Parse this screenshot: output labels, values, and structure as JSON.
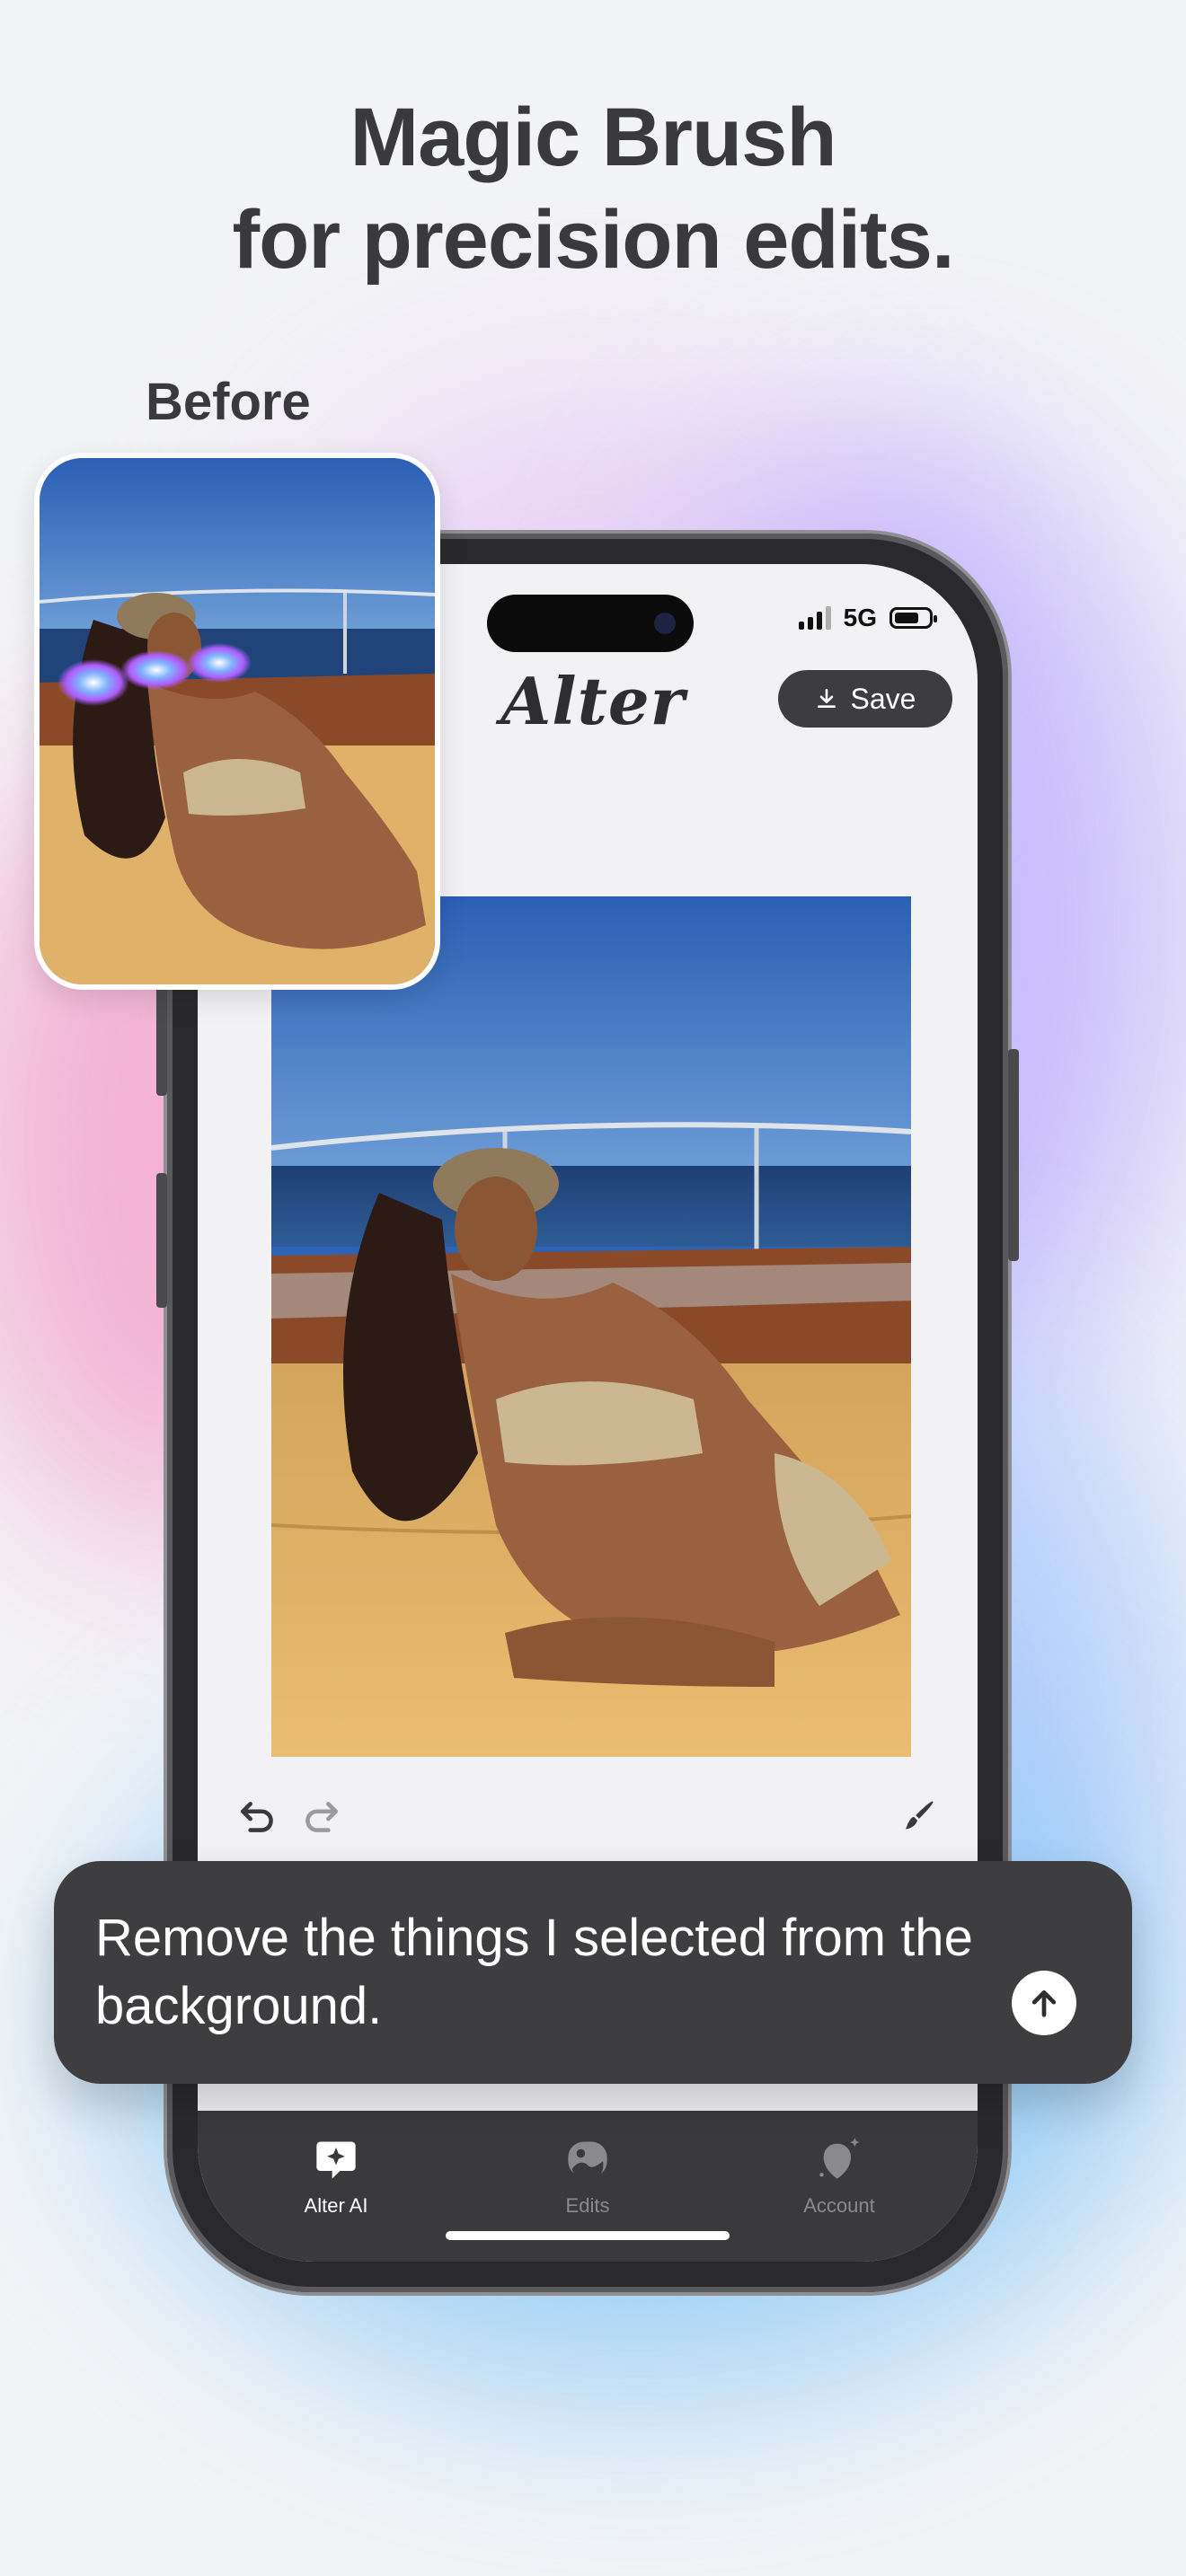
{
  "headline": {
    "line1": "Magic Brush",
    "line2": "for precision edits."
  },
  "before_label": "Before",
  "status_bar": {
    "network": "5G"
  },
  "app": {
    "logo": "Alter",
    "save_label": "Save"
  },
  "editor": {
    "undo_icon": "undo-icon",
    "redo_icon": "redo-icon",
    "brush_icon": "brush-icon"
  },
  "prompt": {
    "text": "Remove the things I selected from the background.",
    "send_icon": "arrow-up-icon"
  },
  "tabs": [
    {
      "label": "Alter AI",
      "icon": "chat-sparkle-icon",
      "active": true
    },
    {
      "label": "Edits",
      "icon": "gallery-icon",
      "active": false
    },
    {
      "label": "Account",
      "icon": "avatar-sparkle-icon",
      "active": false
    }
  ],
  "colors": {
    "background": "#f3f4f6",
    "headline": "#3a3a3c",
    "button_dark": "#3d3d40",
    "tab_bar": "#3a3a3d",
    "tab_inactive": "#8a8a8e",
    "glow_pink": "#f3a6cf",
    "glow_violet": "#b9a8ff",
    "glow_blue": "#8fcaf6"
  }
}
